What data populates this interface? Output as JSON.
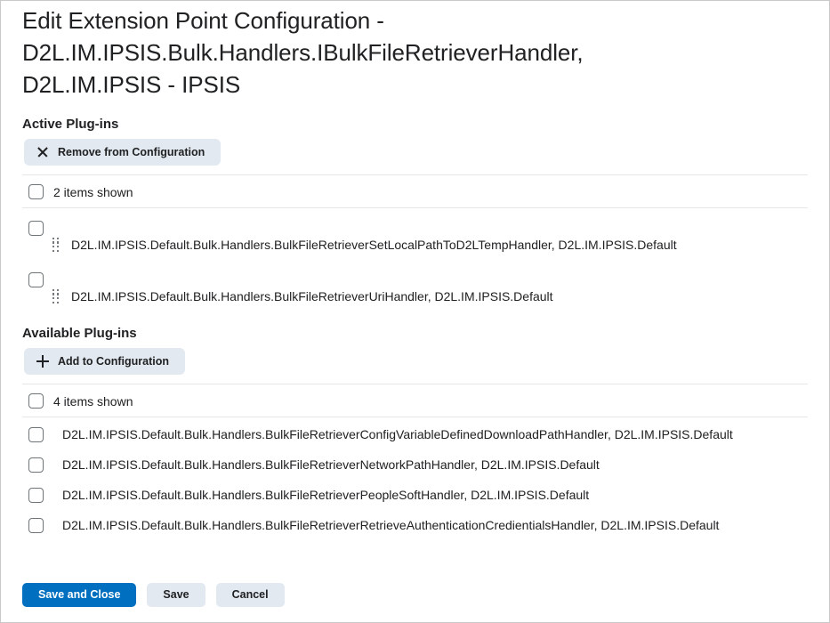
{
  "page": {
    "title": "Edit Extension Point Configuration - D2L.IM.IPSIS.Bulk.Handlers.IBulkFileRetrieverHandler, D2L.IM.IPSIS - IPSIS"
  },
  "colors": {
    "primary_button": "#006FBF",
    "secondary_button": "#E3E9F1",
    "text": "#202122",
    "divider": "#E6E6E6",
    "checkbox_border": "#6E7477",
    "page_border": "#C9C9C9"
  },
  "active_section": {
    "heading": "Active Plug-ins",
    "toolbar": {
      "remove_label": "Remove from Configuration",
      "remove_icon": "close-x-icon"
    },
    "select_all_label": "2 items shown",
    "rows": [
      {
        "name": "D2L.IM.IPSIS.Default.Bulk.Handlers.BulkFileRetrieverSetLocalPathToD2LTempHandler, D2L.IM.IPSIS.Default",
        "drag_icon": "drag-handle-icon",
        "checked": false
      },
      {
        "name": "D2L.IM.IPSIS.Default.Bulk.Handlers.BulkFileRetrieverUriHandler, D2L.IM.IPSIS.Default",
        "drag_icon": "drag-handle-icon",
        "checked": false
      }
    ]
  },
  "available_section": {
    "heading": "Available Plug-ins",
    "toolbar": {
      "add_label": "Add to Configuration",
      "add_icon": "plus-icon"
    },
    "select_all_label": "4 items shown",
    "rows": [
      {
        "name": "D2L.IM.IPSIS.Default.Bulk.Handlers.BulkFileRetrieverConfigVariableDefinedDownloadPathHandler, D2L.IM.IPSIS.Default",
        "checked": false
      },
      {
        "name": "D2L.IM.IPSIS.Default.Bulk.Handlers.BulkFileRetrieverNetworkPathHandler, D2L.IM.IPSIS.Default",
        "checked": false
      },
      {
        "name": "D2L.IM.IPSIS.Default.Bulk.Handlers.BulkFileRetrieverPeopleSoftHandler, D2L.IM.IPSIS.Default",
        "checked": false
      },
      {
        "name": "D2L.IM.IPSIS.Default.Bulk.Handlers.BulkFileRetrieverRetrieveAuthenticationCredientialsHandler, D2L.IM.IPSIS.Default",
        "checked": false
      }
    ]
  },
  "footer": {
    "save_and_close_label": "Save and Close",
    "save_label": "Save",
    "cancel_label": "Cancel"
  }
}
